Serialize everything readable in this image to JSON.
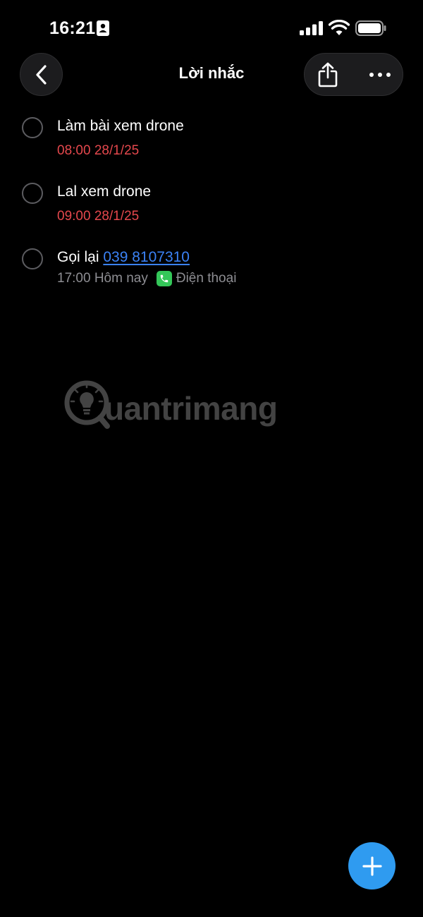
{
  "status_bar": {
    "time": "16:21"
  },
  "header": {
    "title": "Lời nhắc"
  },
  "reminders": [
    {
      "title": "Làm bài xem drone",
      "due": "08:00 28/1/25",
      "overdue": true
    },
    {
      "title": "Lal xem drone",
      "due": "09:00 28/1/25",
      "overdue": true
    },
    {
      "title_prefix": "Gọi lại ",
      "phone_number": "039 8107310",
      "due": "17:00 Hôm nay",
      "source_label": "Điện thoại",
      "overdue": false
    }
  ],
  "watermark": {
    "text": "uantrimang"
  },
  "colors": {
    "background": "#000000",
    "overdue": "#e5484d",
    "link": "#3b82f6",
    "fab": "#2f9bf0",
    "phone_badge": "#34c759"
  },
  "icons": {
    "back": "chevron-left-icon",
    "share": "share-icon",
    "more": "ellipsis-icon",
    "add": "plus-icon",
    "phone": "phone-icon"
  }
}
